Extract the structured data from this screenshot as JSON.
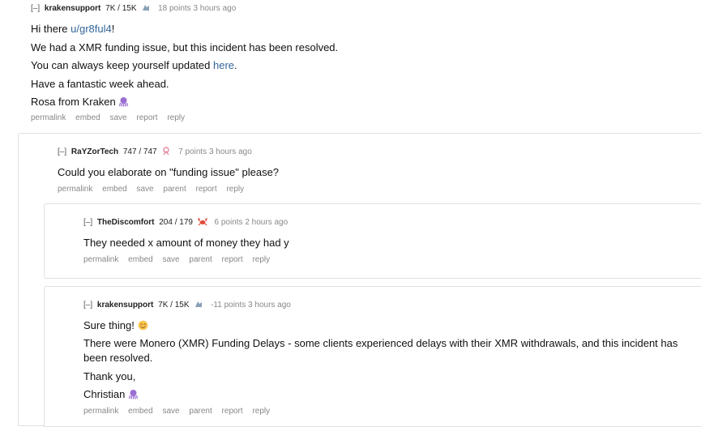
{
  "c1": {
    "toggle": "[–]",
    "author": "krakensupport",
    "karma": "7K / 15K",
    "score": "18 points",
    "time": "3 hours ago",
    "hi_prefix": "Hi there ",
    "hi_link": "u/gr8ful4",
    "hi_suffix": "!",
    "line2": "We had a XMR funding issue, but this incident has been resolved.",
    "line3_prefix": "You can always keep yourself updated ",
    "line3_link": "here",
    "line3_suffix": ".",
    "line4": "Have a fantastic week ahead.",
    "line5": "Rosa from Kraken",
    "buttons": [
      "permalink",
      "embed",
      "save",
      "report",
      "reply"
    ]
  },
  "c2": {
    "toggle": "[–]",
    "author": "RaYZorTech",
    "karma": "747 / 747",
    "score": "7 points",
    "time": "3 hours ago",
    "body": "Could you elaborate on \"funding issue\" please?",
    "buttons": [
      "permalink",
      "embed",
      "save",
      "parent",
      "report",
      "reply"
    ]
  },
  "c3": {
    "toggle": "[–]",
    "author": "TheDiscomfort",
    "karma": "204 / 179",
    "score": "6 points",
    "time": "2 hours ago",
    "body": "They needed x amount of money they had y",
    "buttons": [
      "permalink",
      "embed",
      "save",
      "parent",
      "report",
      "reply"
    ]
  },
  "c4": {
    "toggle": "[–]",
    "author": "krakensupport",
    "karma": "7K / 15K",
    "score": "-11 points",
    "time": "3 hours ago",
    "line1": "Sure thing!",
    "line2": "There were Monero (XMR) Funding Delays - some clients experienced delays with their XMR withdrawals, and this incident has been resolved.",
    "line3": "Thank you,",
    "line4": "Christian",
    "buttons": [
      "permalink",
      "embed",
      "save",
      "parent",
      "report",
      "reply"
    ]
  },
  "icons": {
    "flair_kraken": "kraken-flair-icon",
    "flair_rayzor": "pink-flair-icon",
    "flair_crab": "crab-flair-icon",
    "octopus": "octopus-emoji",
    "smile": "smiling-emoji"
  },
  "colors": {
    "link": "#336699",
    "octopus": "#9b6fd1",
    "crab": "#e04a3a"
  }
}
